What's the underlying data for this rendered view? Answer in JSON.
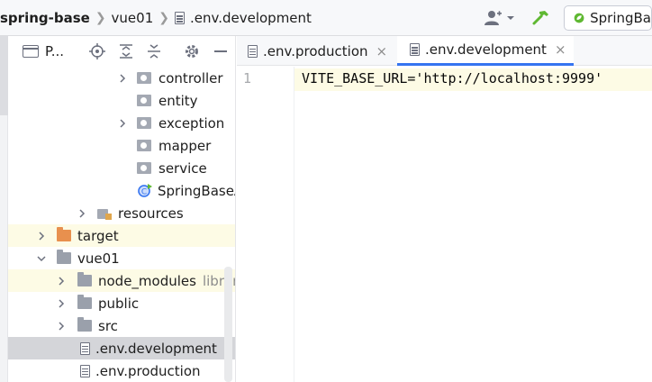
{
  "breadcrumb": {
    "project": "spring-base",
    "folder": "vue01",
    "file": ".env.development"
  },
  "toolbar": {
    "run_config_label": "SpringBa"
  },
  "project_panel": {
    "title": "P..."
  },
  "tree": [
    {
      "label": "controller",
      "type": "package",
      "expandable": true
    },
    {
      "label": "entity",
      "type": "package",
      "expandable": false
    },
    {
      "label": "exception",
      "type": "package",
      "expandable": true
    },
    {
      "label": "mapper",
      "type": "package",
      "expandable": false
    },
    {
      "label": "service",
      "type": "package",
      "expandable": false
    },
    {
      "label": "SpringBaseA",
      "type": "spring-class",
      "expandable": false
    },
    {
      "label": "resources",
      "type": "resources-folder",
      "expandable": true
    },
    {
      "label": "target",
      "type": "excluded-folder",
      "expandable": true
    },
    {
      "label": "vue01",
      "type": "folder",
      "expandable": true,
      "expanded": true
    },
    {
      "label": "node_modules",
      "type": "folder",
      "expandable": true,
      "suffix": "librar"
    },
    {
      "label": "public",
      "type": "folder",
      "expandable": true
    },
    {
      "label": "src",
      "type": "folder",
      "expandable": true
    },
    {
      "label": ".env.development",
      "type": "file",
      "expandable": false,
      "selected": true
    },
    {
      "label": ".env.production",
      "type": "file",
      "expandable": false
    }
  ],
  "editor": {
    "tabs": [
      {
        "label": ".env.production",
        "close": "×",
        "active": false
      },
      {
        "label": ".env.development",
        "close": "×",
        "active": true
      }
    ],
    "line_number": "1",
    "code_line": "VITE_BASE_URL='http://localhost:9999'"
  },
  "colors": {
    "accent": "#3574f0",
    "current_line": "#fdfbe5",
    "selection": "#d4d5d9",
    "spring_green": "#5fb832",
    "excluded_folder": "#e8904e"
  }
}
